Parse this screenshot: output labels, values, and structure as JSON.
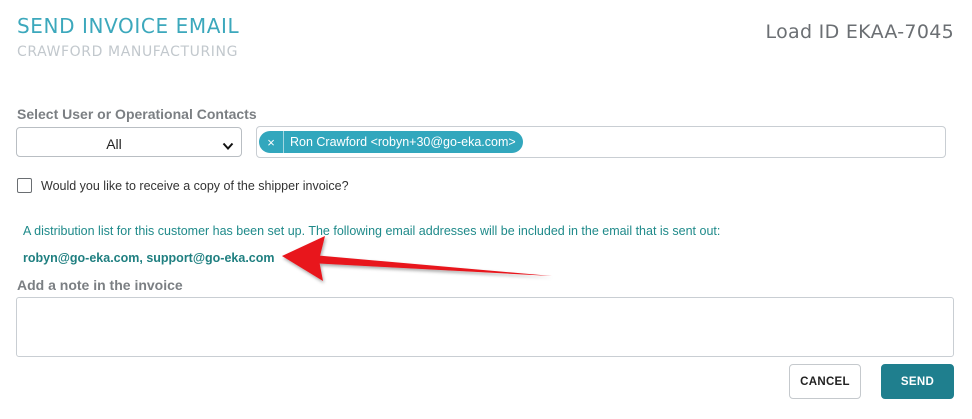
{
  "header": {
    "title": "SEND INVOICE EMAIL",
    "subtitle": "CRAWFORD MANUFACTURING",
    "load_id": "Load ID EKAA-7045"
  },
  "contacts": {
    "label": "Select User or Operational Contacts",
    "select_value": "All",
    "chips": [
      {
        "remove_glyph": "×",
        "label": "Ron Crawford <robyn+30@go-eka.com>"
      }
    ]
  },
  "copy_option": {
    "label": "Would you like to receive a copy of the shipper invoice?",
    "checked": false
  },
  "distribution": {
    "text": "A distribution list for this customer has been set up. The following email addresses will be included in the email that is sent out:",
    "emails": "robyn@go-eka.com, support@go-eka.com"
  },
  "note": {
    "label": "Add a note in the invoice",
    "value": "",
    "placeholder": ""
  },
  "actions": {
    "cancel_label": "CANCEL",
    "send_label": "SEND"
  },
  "colors": {
    "accent": "#3ca8bc",
    "primary_button": "#1f7f8e",
    "chip": "#32a7bd",
    "info_text": "#1f8a8a",
    "annotation_arrow": "#e8141c"
  },
  "icons": {
    "select_caret": "chevron-down-icon",
    "chip_remove": "close-icon",
    "annotation": "red-arrow-icon"
  }
}
